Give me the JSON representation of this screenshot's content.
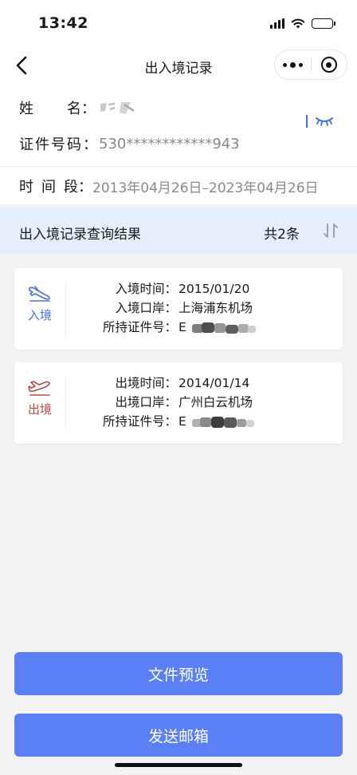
{
  "status_bar": {
    "time": "13:42"
  },
  "nav": {
    "title": "出入境记录"
  },
  "info": {
    "name_label": [
      "姓",
      "名："
    ],
    "id_label": "证件号码：",
    "id_value": "530************943",
    "period_label": [
      "时",
      "间",
      "段："
    ],
    "period_value": "2013年04月26日–2023年04月26日"
  },
  "results": {
    "title": "出入境记录查询结果",
    "count": "共2条"
  },
  "records": [
    {
      "type": "入境",
      "type_color": "#4a72d6",
      "icon": "plane-landing-icon",
      "time_label": "入境时间：",
      "time_value": "2015/01/20",
      "port_label": "入境口岸：",
      "port_value": "上海浦东机场",
      "doc_label": "所持证件号：",
      "doc_prefix": "E"
    },
    {
      "type": "出境",
      "type_color": "#b84848",
      "icon": "plane-takeoff-icon",
      "time_label": "出境时间：",
      "time_value": "2014/01/14",
      "port_label": "出境口岸：",
      "port_value": "广州白云机场",
      "doc_label": "所持证件号：",
      "doc_prefix": "E"
    }
  ],
  "buttons": {
    "preview": "文件预览",
    "send": "发送邮箱"
  },
  "colors": {
    "primary_button": "#5b80f6",
    "results_header_bg": "#e5eefd",
    "eye_toggle": "#3d6fe8"
  }
}
